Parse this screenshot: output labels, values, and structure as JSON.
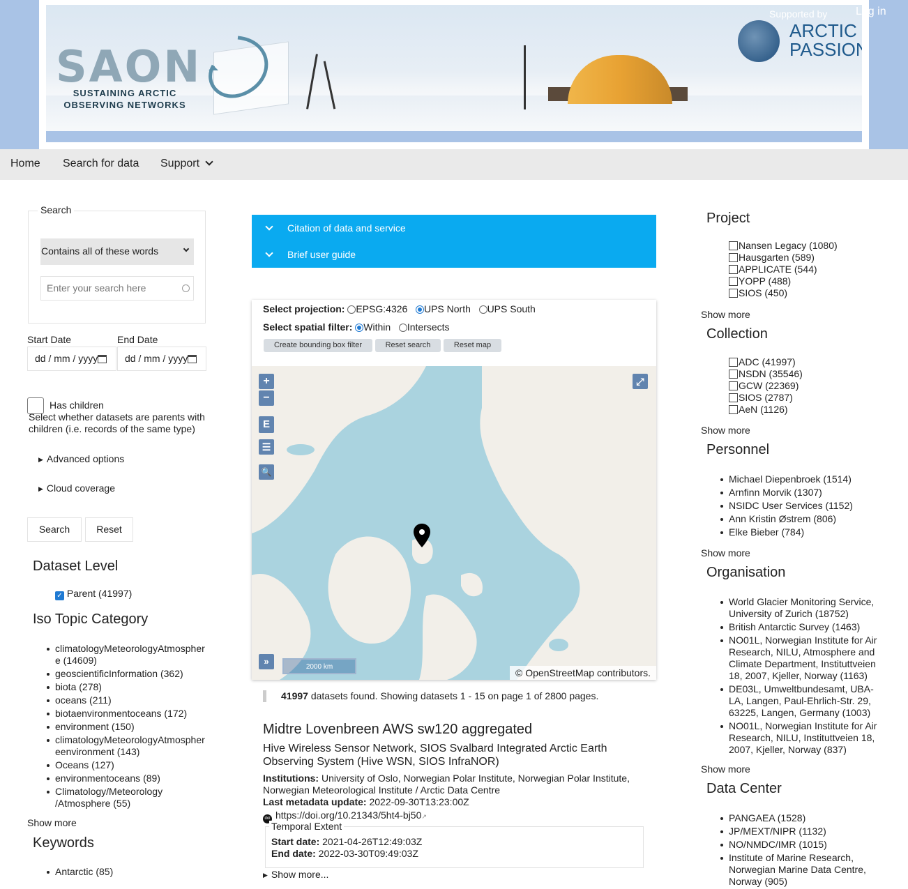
{
  "header": {
    "logo_text": "SAON",
    "logo_sub_1": "SUSTAINING ARCTIC",
    "logo_sub_2": "OBSERVING NETWORKS",
    "supported_by": "Supported by",
    "partner_1": "ARCTIC",
    "partner_2": "PASSION",
    "login": "Log in"
  },
  "nav": {
    "home": "Home",
    "search_for_data": "Search for data",
    "support": "Support"
  },
  "search": {
    "legend": "Search",
    "mode_selected": "Contains all of these words",
    "placeholder": "Enter your search here",
    "start_date_label": "Start Date",
    "end_date_label": "End Date",
    "date_placeholder": "dd / mm / yyyy",
    "has_children_label": "Has children",
    "has_children_help": "Select whether datasets are parents with children (i.e. records of the same type)",
    "advanced_options": "Advanced options",
    "cloud_coverage": "Cloud coverage",
    "search_button": "Search",
    "reset_button": "Reset"
  },
  "dataset_level": {
    "title": "Dataset Level",
    "items": [
      "Parent (41997)"
    ]
  },
  "iso_topic": {
    "title": "Iso Topic Category",
    "items": [
      "climatologyMeteorologyAtmosphere (14609)",
      "geoscientificInformation (362)",
      "biota (278)",
      "oceans (211)",
      "biotaenvironmentoceans (172)",
      "environment (150)",
      "climatologyMeteorologyAtmosphereenvironment (143)",
      "Oceans (127)",
      "environmentoceans (89)",
      "Climatology/Meteorology /Atmosphere (55)"
    ],
    "show_more": "Show more"
  },
  "keywords": {
    "title": "Keywords",
    "items": [
      "Antarctic (85)"
    ]
  },
  "accordion": {
    "citation": "Citation of data and service",
    "guide": "Brief user guide"
  },
  "map": {
    "projection_label": "Select projection:",
    "projections": [
      "EPSG:4326",
      "UPS North",
      "UPS South"
    ],
    "projection_selected": "UPS North",
    "filter_label": "Select spatial filter:",
    "filters": [
      "Within",
      "Intersects"
    ],
    "filter_selected": "Within",
    "btn_bbox": "Create bounding box filter",
    "btn_reset_search": "Reset search",
    "btn_reset_map": "Reset map",
    "zoom_in": "+",
    "zoom_out": "−",
    "ctl_e": "E",
    "ctl_menu": "☰",
    "ctl_search": "🔍",
    "ctl_expand": "»",
    "ctl_fullscreen": "⤢",
    "scale": "2000 km",
    "attribution": "© OpenStreetMap contributors."
  },
  "results": {
    "count": "41997",
    "summary": " datasets found. Showing datasets 1 - 15 on page 1 of 2800 pages."
  },
  "dataset": {
    "title": "Midtre Lovenbreen AWS sw120 aggregated",
    "subtitle": "Hive Wireless Sensor Network, SIOS Svalbard Integrated Arctic Earth Observing System (Hive WSN, SIOS InfraNOR)",
    "institutions_label": "Institutions:",
    "institutions": " University of Oslo, Norwegian Polar Institute, Norwegian Polar Institute, Norwegian Meteorological Institute / Arctic Data Centre",
    "updated_label": "Last metadata update:",
    "updated": " 2022-09-30T13:23:00Z",
    "doi": "https://doi.org/10.21343/5ht4-bj50",
    "temporal_legend": "Temporal Extent",
    "start_label": "Start date:",
    "start": " 2021-04-26T12:49:03Z",
    "end_label": "End date:",
    "end": " 2022-03-30T09:49:03Z",
    "show_more": "Show more..."
  },
  "project": {
    "title": "Project",
    "items": [
      "Nansen Legacy (1080)",
      "Hausgarten (589)",
      "APPLICATE (544)",
      "YOPP (488)",
      "SIOS (450)"
    ],
    "show_more": "Show more"
  },
  "collection": {
    "title": "Collection",
    "items": [
      "ADC (41997)",
      "NSDN (35546)",
      "GCW (22369)",
      "SIOS (2787)",
      "AeN (1126)"
    ],
    "show_more": "Show more"
  },
  "personnel": {
    "title": "Personnel",
    "items": [
      "Michael Diepenbroek (1514)",
      "Arnfinn Morvik (1307)",
      "NSIDC User Services (1152)",
      "Ann Kristin Østrem (806)",
      "Elke Bieber (784)"
    ],
    "show_more": "Show more"
  },
  "organisation": {
    "title": "Organisation",
    "items": [
      "World Glacier Monitoring Service, University of Zurich (18752)",
      "British Antarctic Survey (1463)",
      "NO01L, Norwegian Institute for Air Research, NILU, Atmosphere and Climate Department, Instituttveien 18, 2007, Kjeller, Norway (1163)",
      "DE03L, Umweltbundesamt, UBA-LA, Langen, Paul-Ehrlich-Str. 29, 63225, Langen, Germany (1003)",
      "NO01L, Norwegian Institute for Air Research, NILU, Instituttveien 18, 2007, Kjeller, Norway (837)"
    ],
    "show_more": "Show more"
  },
  "data_center": {
    "title": "Data Center",
    "items": [
      "PANGAEA (1528)",
      "JP/MEXT/NIPR (1132)",
      "NO/NMDC/IMR (1015)",
      "Institute of Marine Research, Norwegian Marine Data Centre, Norway (905)"
    ]
  }
}
